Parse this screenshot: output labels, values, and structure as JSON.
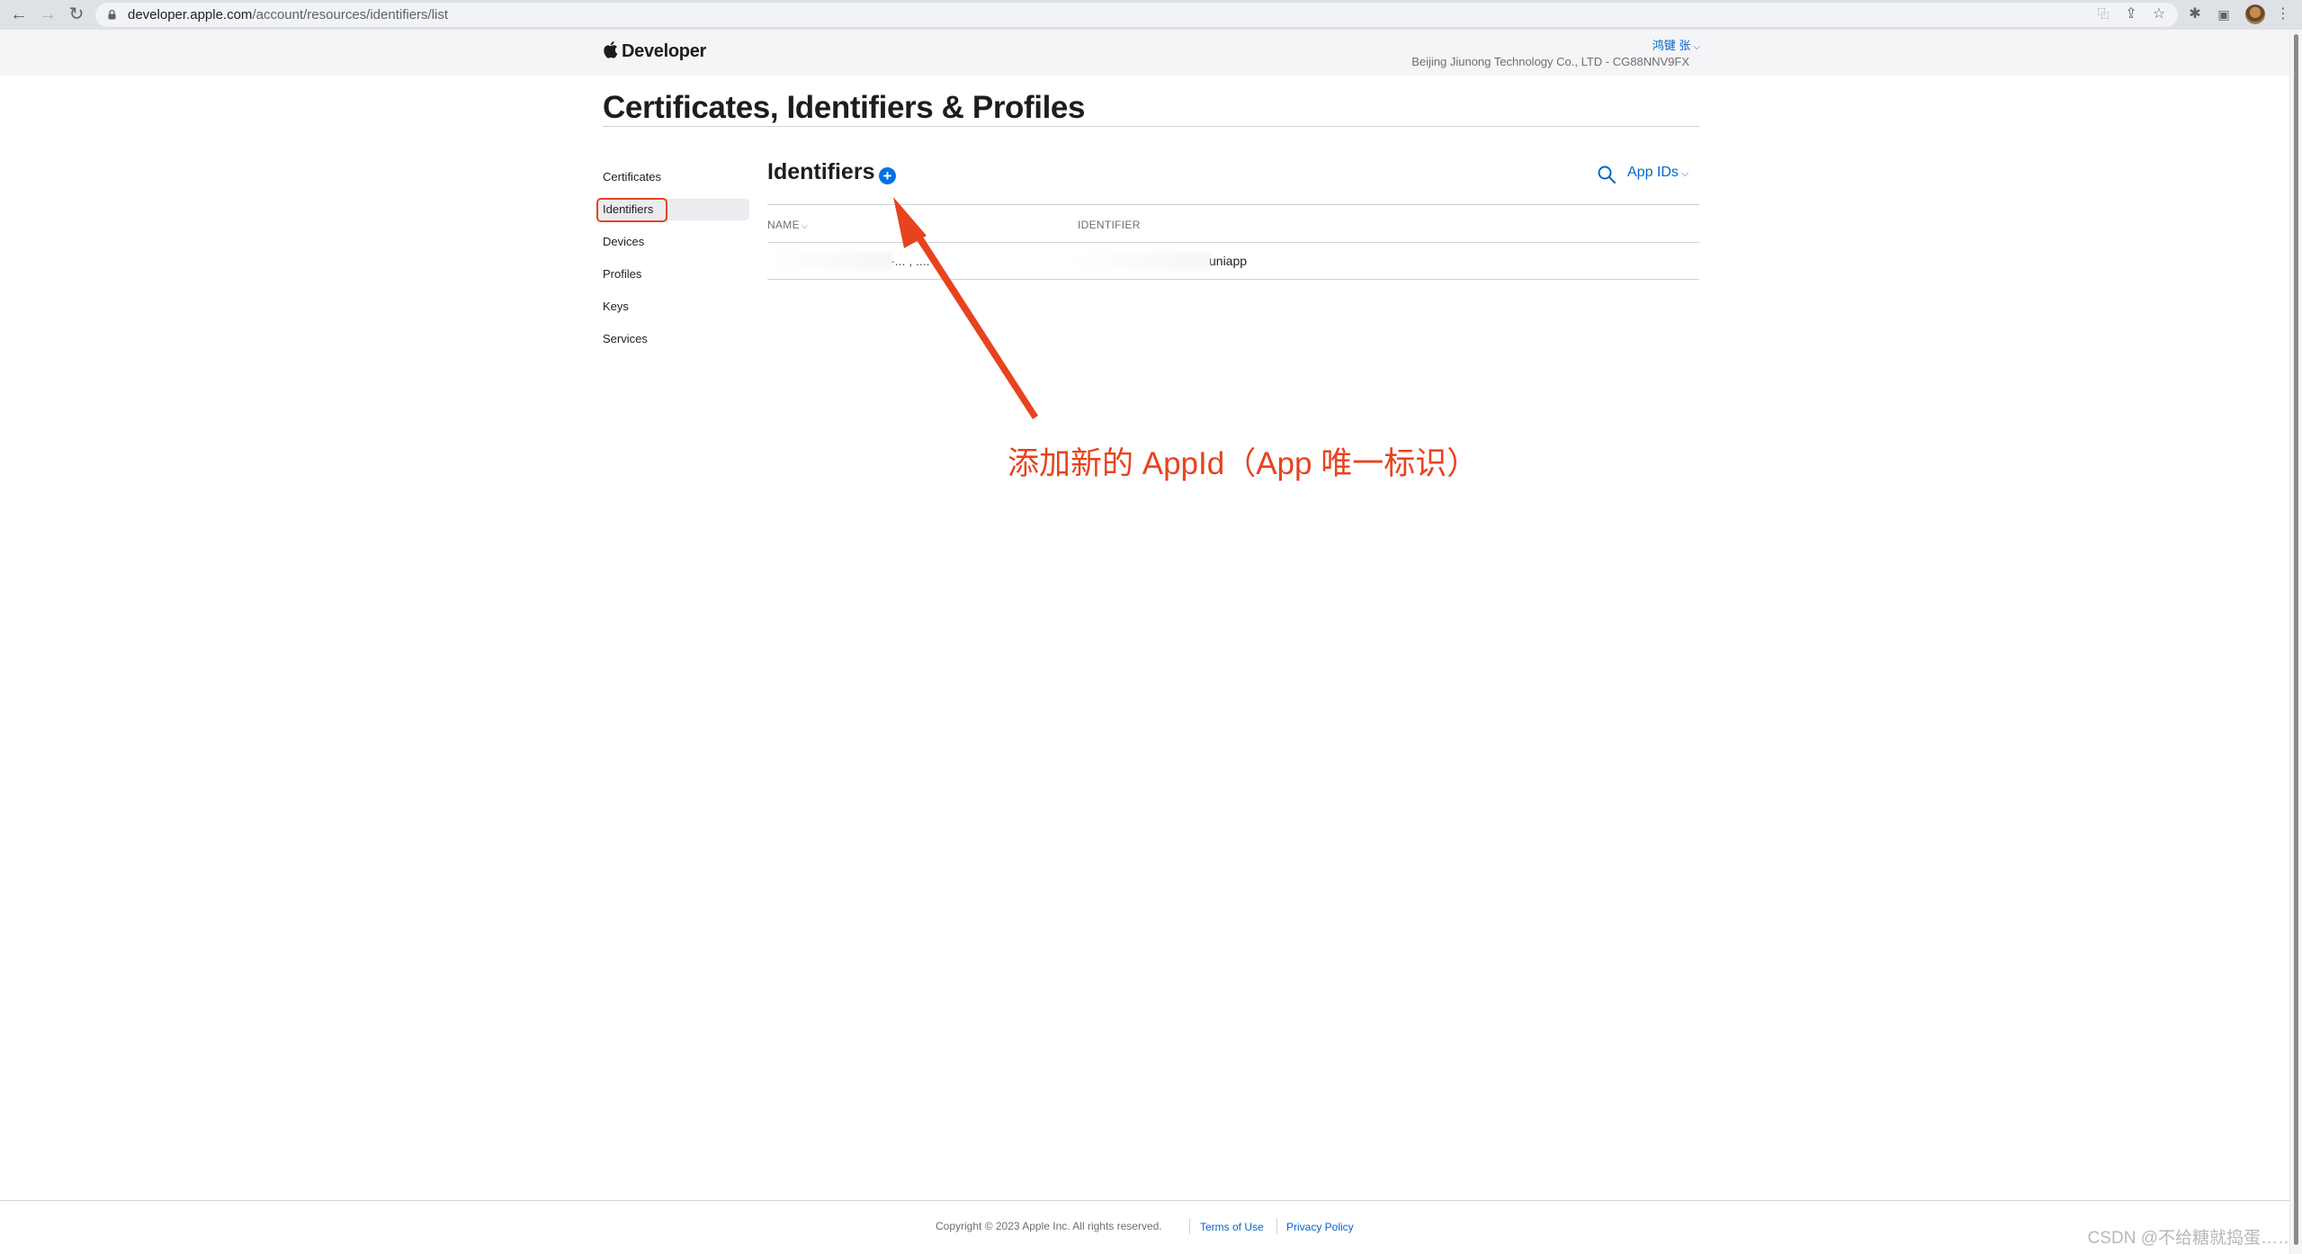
{
  "browser": {
    "url_host": "developer.apple.com",
    "url_path": "/account/resources/identifiers/list"
  },
  "header": {
    "brand": "Developer",
    "user_name": "鸿键 张",
    "team_name": "Beijing Jiunong Technology Co., LTD - CG88NNV9FX"
  },
  "page_title": "Certificates, Identifiers & Profiles",
  "sidebar": {
    "items": [
      {
        "label": "Certificates"
      },
      {
        "label": "Identifiers"
      },
      {
        "label": "Devices"
      },
      {
        "label": "Profiles"
      },
      {
        "label": "Keys"
      },
      {
        "label": "Services"
      }
    ],
    "active": "Identifiers"
  },
  "content": {
    "heading": "Identifiers",
    "add_icon": "plus-circle-icon",
    "filter_label": "App IDs",
    "columns": {
      "name": "NAME",
      "identifier": "IDENTIFIER"
    },
    "rows": [
      {
        "name_visible": "-... , ....",
        "identifier_visible": "uniapp"
      }
    ]
  },
  "annotation": {
    "text": "添加新的 AppId（App 唯一标识）",
    "color": "#e8431e"
  },
  "footer": {
    "copyright": "Copyright © 2023 Apple Inc. All rights reserved.",
    "terms": "Terms of Use",
    "privacy": "Privacy Policy"
  },
  "watermark": "CSDN @不给糖就捣蛋……",
  "colors": {
    "accent": "#0071e3",
    "link": "#0066cc",
    "annotation": "#e8431e"
  }
}
